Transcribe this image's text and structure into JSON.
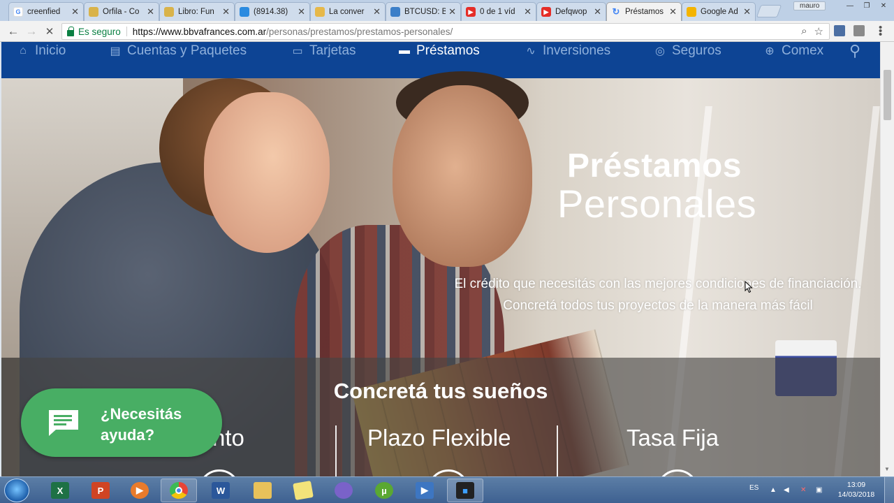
{
  "browser": {
    "tabs": [
      {
        "title": "creenfied",
        "favicon": "google-icon",
        "color": "#4285f4",
        "active": false
      },
      {
        "title": "Orfila - Co",
        "favicon": "coin-icon",
        "color": "#d9b34a",
        "active": false
      },
      {
        "title": "Libro: Fun",
        "favicon": "coin-icon",
        "color": "#d9b34a",
        "active": false
      },
      {
        "title": "(8914.38)",
        "favicon": "chart-icon",
        "color": "#2b8be0",
        "active": false
      },
      {
        "title": "La conver",
        "favicon": "folder-icon",
        "color": "#e6b84a",
        "active": false
      },
      {
        "title": "BTCUSD: B",
        "favicon": "chart-icon",
        "color": "#3c7fc8",
        "active": false
      },
      {
        "title": "0 de 1 víd",
        "favicon": "youtube-icon",
        "color": "#e52d27",
        "active": false
      },
      {
        "title": "Defqwop",
        "favicon": "youtube-icon",
        "color": "#e52d27",
        "active": false
      },
      {
        "title": "Préstamos",
        "favicon": "loading-icon",
        "color": "#4285f4",
        "active": true
      },
      {
        "title": "Google Ad",
        "favicon": "drive-icon",
        "color": "#f4b400",
        "active": false
      }
    ],
    "user": "mauro",
    "security_label": "Es seguro",
    "url_host": "https://www.bbvafrances.com.ar",
    "url_path": "/personas/prestamos/prestamos-personales/"
  },
  "nav": {
    "items": [
      {
        "label": "Inicio",
        "icon": "home-icon",
        "active": false
      },
      {
        "label": "Cuentas y Paquetes",
        "icon": "accounts-icon",
        "active": false
      },
      {
        "label": "Tarjetas",
        "icon": "card-icon",
        "active": false
      },
      {
        "label": "Préstamos",
        "icon": "loan-icon",
        "active": true
      },
      {
        "label": "Inversiones",
        "icon": "trend-icon",
        "active": false
      },
      {
        "label": "Seguros",
        "icon": "lifebuoy-icon",
        "active": false
      },
      {
        "label": "Comex",
        "icon": "globe-icon",
        "active": false
      }
    ],
    "search_icon": "search-icon"
  },
  "hero": {
    "title_line1": "Préstamos",
    "title_line2": "Personales",
    "description": "El crédito que necesitás con las mejores condiciones de financiación. Concretá todos tus proyectos de la manera más fácil"
  },
  "band": {
    "title": "Concretá tus sueños",
    "features": [
      "nto",
      "Plazo Flexible",
      "Tasa Fija"
    ]
  },
  "help": {
    "line1": "¿Necesitás",
    "line2": "ayuda?"
  },
  "taskbar": {
    "apps": [
      {
        "name": "excel",
        "letter": "X",
        "color": "#1e7145",
        "running": false
      },
      {
        "name": "powerpoint",
        "letter": "P",
        "color": "#d04423",
        "running": false
      },
      {
        "name": "media",
        "letter": "▶",
        "color": "#e87b2c",
        "running": false
      },
      {
        "name": "chrome",
        "letter": "",
        "color": "#e84436",
        "running": true
      },
      {
        "name": "word",
        "letter": "W",
        "color": "#2b579a",
        "running": false
      },
      {
        "name": "explorer",
        "letter": "",
        "color": "#e8c15a",
        "running": false
      },
      {
        "name": "notes",
        "letter": "",
        "color": "#f3e37a",
        "running": false
      },
      {
        "name": "torrent",
        "letter": "",
        "color": "#7a62c9",
        "running": false
      },
      {
        "name": "utorrent",
        "letter": "µ",
        "color": "#5aa832",
        "running": false
      },
      {
        "name": "player",
        "letter": "▶",
        "color": "#3d76c2",
        "running": false
      },
      {
        "name": "recorder",
        "letter": "■",
        "color": "#222",
        "running": true
      }
    ],
    "language": "ES",
    "time": "13:09",
    "date": "14/03/2018"
  }
}
